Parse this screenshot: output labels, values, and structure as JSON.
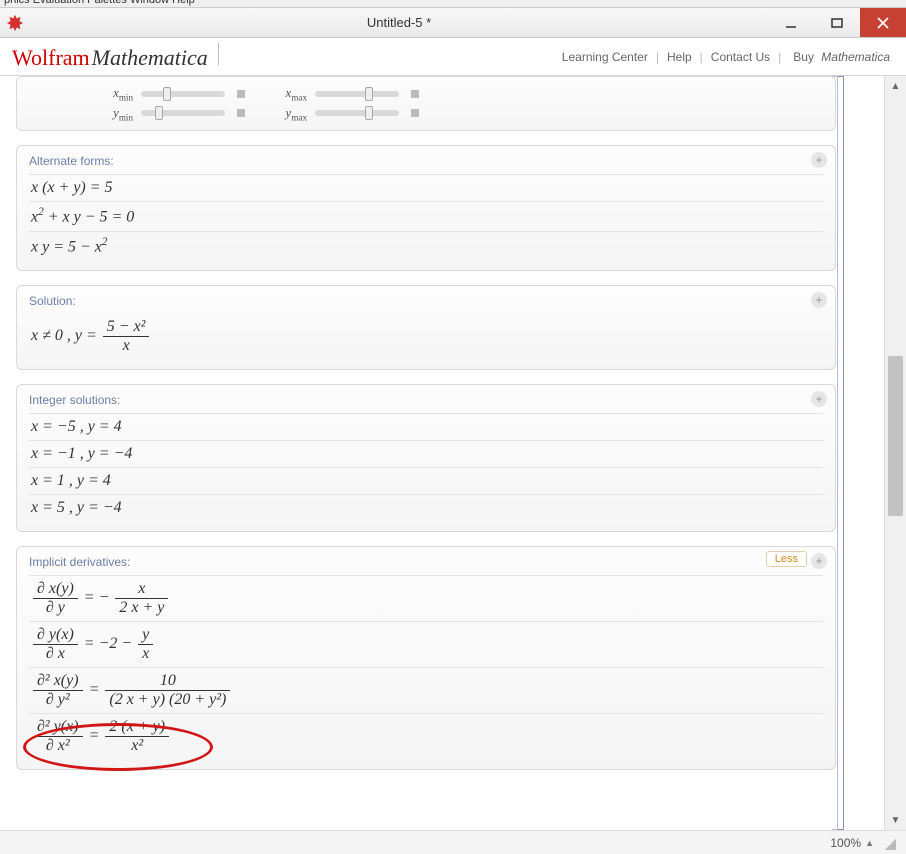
{
  "window": {
    "title": "Untitled-5 *",
    "menu_fragment": "phics   Evaluation   Palettes   Window   Help"
  },
  "brand": {
    "wolfram": "Wolfram",
    "mathematica": "Mathematica",
    "learning_center": "Learning Center",
    "help": "Help",
    "contact": "Contact Us",
    "buy_prefix": "Buy ",
    "buy_em": "Mathematica"
  },
  "sliders": {
    "xmin": "x",
    "xmin_sub": "min",
    "xmax": "x",
    "xmax_sub": "max",
    "ymin": "y",
    "ymin_sub": "min",
    "ymax": "y",
    "ymax_sub": "max"
  },
  "alternate": {
    "title": "Alternate forms:",
    "r1": "x (x + y) = 5",
    "r2a": "x",
    "r2b": " + x y − 5 = 0",
    "r3a": "x y = 5 − x",
    "r3sup": "2"
  },
  "solution": {
    "title": "Solution:",
    "lead": "x ≠ 0 ,    y = ",
    "num": "5 − x²",
    "den": "x"
  },
  "integer": {
    "title": "Integer solutions:",
    "r1": "x = −5 ,    y = 4",
    "r2": "x = −1 ,    y = −4",
    "r3": "x = 1 ,    y = 4",
    "r4": "x = 5 ,    y = −4"
  },
  "deriv": {
    "title": "Implicit derivatives:",
    "less": "Less",
    "r1": {
      "lnum": "∂ x(y)",
      "lden": "∂ y",
      "eq": " = −",
      "rnum": "x",
      "rden": "2 x + y"
    },
    "r2": {
      "lnum": "∂ y(x)",
      "lden": "∂ x",
      "eq": " = −2 − ",
      "rnum": "y",
      "rden": "x"
    },
    "r3": {
      "lnum": "∂² x(y)",
      "lden": "∂ y²",
      "eq": " = ",
      "rnum": "10",
      "rden": "(2 x + y) (20 + y²)"
    },
    "r4": {
      "lnum": "∂² y(x)",
      "lden": "∂ x²",
      "eq": " = ",
      "rnum": "2 (x + y)",
      "rden": "x²"
    }
  },
  "status": {
    "zoom": "100%"
  }
}
